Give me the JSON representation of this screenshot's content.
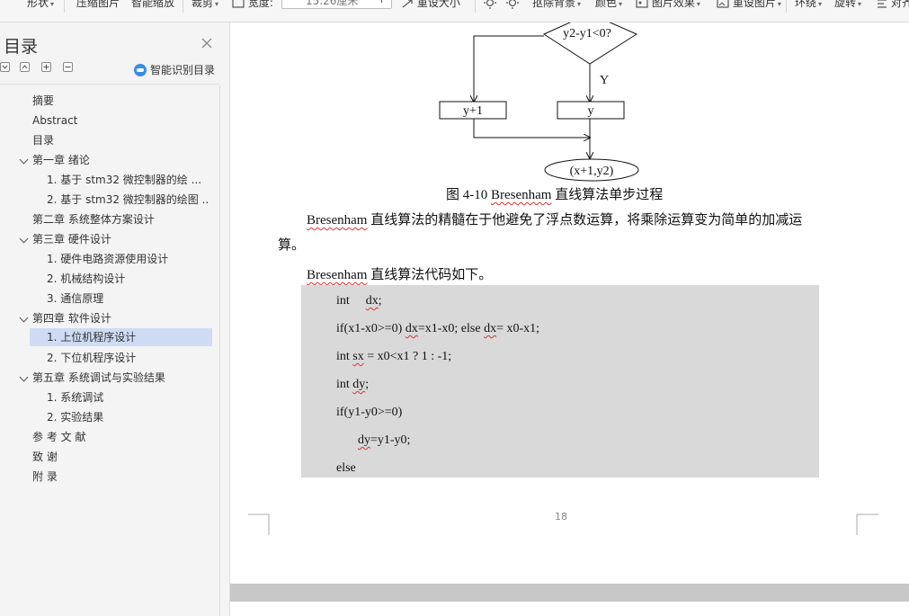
{
  "toolbar": {
    "items": [
      "形状",
      "压缩图片",
      "智能缩放",
      "裁剪",
      "宽度:",
      "15.26厘米",
      "重设大小",
      "抠除背景",
      "颜色",
      "图片效果",
      "重设图片",
      "环绕",
      "旋转",
      "对齐"
    ]
  },
  "sidebar": {
    "title": "目录",
    "ai_label": "智能识别目录",
    "items": [
      {
        "label": "摘要"
      },
      {
        "label": "Abstract"
      },
      {
        "label": "目录"
      },
      {
        "label": "第一章 绪论"
      },
      {
        "label": "1. 基于 stm32 微控制器的绘 ..."
      },
      {
        "label": "2. 基于 stm32 微控制器的绘图 ..."
      },
      {
        "label": "第二章 系统整体方案设计"
      },
      {
        "label": "第三章 硬件设计"
      },
      {
        "label": "1. 硬件电路资源使用设计"
      },
      {
        "label": "2. 机械结构设计"
      },
      {
        "label": "3. 通信原理"
      },
      {
        "label": "第四章 软件设计"
      },
      {
        "label": "1. 上位机程序设计"
      },
      {
        "label": "2. 下位机程序设计"
      },
      {
        "label": "第五章 系统调试与实验结果"
      },
      {
        "label": "1. 系统调试"
      },
      {
        "label": "2. 实验结果"
      },
      {
        "label": "参 考 文 献"
      },
      {
        "label": "致 谢"
      },
      {
        "label": "附 录"
      }
    ]
  },
  "document": {
    "flowchart": {
      "decision": "y2-y1<0?",
      "yes_label": "Y",
      "box_left": "y+1",
      "box_right": "y",
      "terminal": "(x+1,y2)"
    },
    "caption": {
      "prefix": "图 4-10 ",
      "word": "Bresenham",
      "suffix": " 直线算法单步过程"
    },
    "paragraph1": {
      "word": "Bresenham",
      "line1_rest": " 直线算法的精髓在于他避免了浮点数运算，将乘除运算变为简单的加减运",
      "line2": "算。"
    },
    "paragraph2": {
      "word": "Bresenham",
      "rest": " 直线算法代码如下。"
    },
    "code": {
      "l1_a": "int",
      "l1_b": "dx",
      "l1_c": ";",
      "l2_a": "if(x1-x0>=0) ",
      "l2_b": "dx",
      "l2_c": "=x1-x0; else ",
      "l2_d": "dx",
      "l2_e": "= x0-x1;",
      "l3_a": "int ",
      "l3_b": "sx",
      "l3_c": " = x0<x1 ? 1 : -1;",
      "l4_a": "int ",
      "l4_b": "dy",
      "l4_c": ";",
      "l5": "if(y1-y0>=0)",
      "l6_a": "dy",
      "l6_b": "=y1-y0;",
      "l7": "else"
    },
    "page_number": "18"
  }
}
